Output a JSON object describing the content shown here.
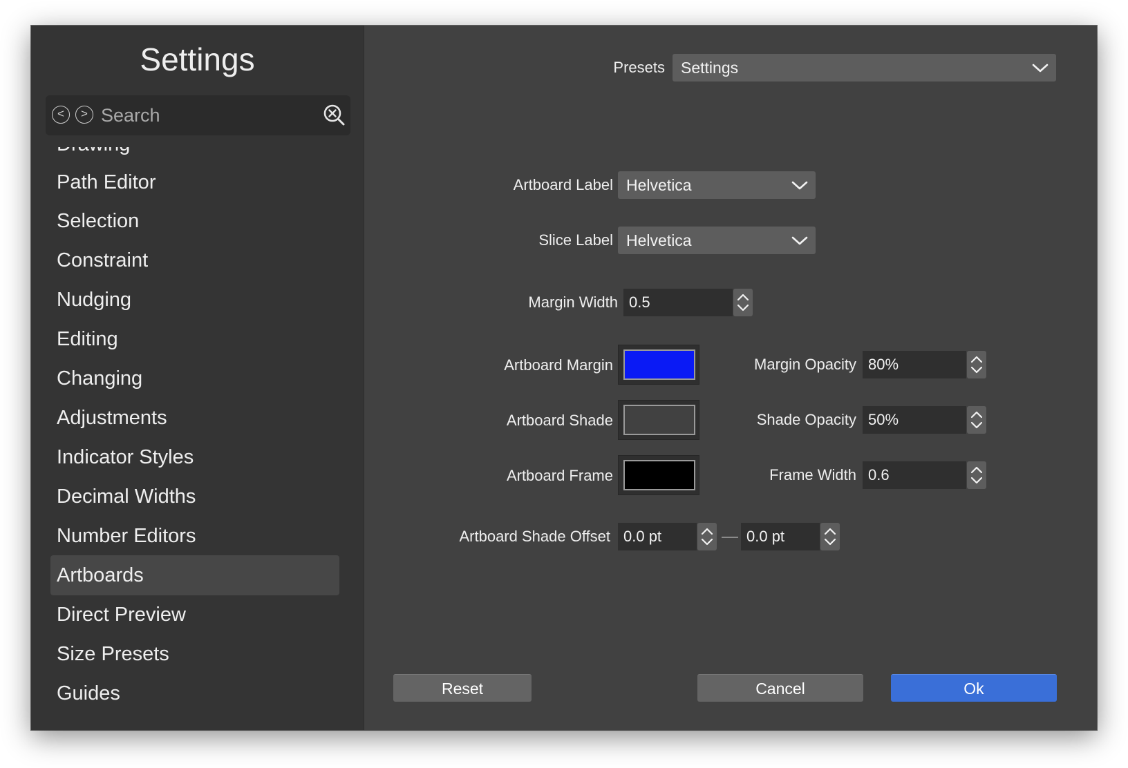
{
  "sidebar": {
    "title": "Settings",
    "search": {
      "placeholder": "Search",
      "value": ""
    },
    "back_glyph": "<",
    "forward_glyph": ">",
    "items": [
      {
        "label": "Drawing",
        "selected": false
      },
      {
        "label": "Path Editor",
        "selected": false
      },
      {
        "label": "Selection",
        "selected": false
      },
      {
        "label": "Constraint",
        "selected": false
      },
      {
        "label": "Nudging",
        "selected": false
      },
      {
        "label": "Editing",
        "selected": false
      },
      {
        "label": "Changing",
        "selected": false
      },
      {
        "label": "Adjustments",
        "selected": false
      },
      {
        "label": "Indicator Styles",
        "selected": false
      },
      {
        "label": "Decimal Widths",
        "selected": false
      },
      {
        "label": "Number Editors",
        "selected": false
      },
      {
        "label": "Artboards",
        "selected": true
      },
      {
        "label": "Direct Preview",
        "selected": false
      },
      {
        "label": "Size Presets",
        "selected": false
      },
      {
        "label": "Guides",
        "selected": false
      }
    ]
  },
  "presets": {
    "label": "Presets",
    "value": "Settings"
  },
  "form": {
    "artboard_label": {
      "label": "Artboard Label",
      "value": "Helvetica"
    },
    "slice_label": {
      "label": "Slice Label",
      "value": "Helvetica"
    },
    "margin_width": {
      "label": "Margin Width",
      "value": "0.5"
    },
    "artboard_margin": {
      "label": "Artboard Margin",
      "color": "#0a1af5"
    },
    "artboard_shade": {
      "label": "Artboard Shade",
      "color": "#414141"
    },
    "artboard_frame": {
      "label": "Artboard Frame",
      "color": "#000000"
    },
    "margin_opacity": {
      "label": "Margin Opacity",
      "value": "80%"
    },
    "shade_opacity": {
      "label": "Shade Opacity",
      "value": "50%"
    },
    "frame_width": {
      "label": "Frame Width",
      "value": "0.6"
    },
    "shade_offset": {
      "label": "Artboard Shade Offset",
      "x": "0.0 pt",
      "y": "0.0 pt"
    }
  },
  "buttons": {
    "reset": "Reset",
    "cancel": "Cancel",
    "ok": "Ok"
  },
  "colors": {
    "accent": "#3a6fd8",
    "window_bg": "#414141",
    "sidebar_bg": "#343434"
  },
  "icons": {
    "back": "chevron-left-circle-icon",
    "forward": "chevron-right-circle-icon",
    "clear": "clear-search-icon",
    "dropdown": "chevron-down-icon",
    "stepper": "up-down-stepper-icon"
  }
}
